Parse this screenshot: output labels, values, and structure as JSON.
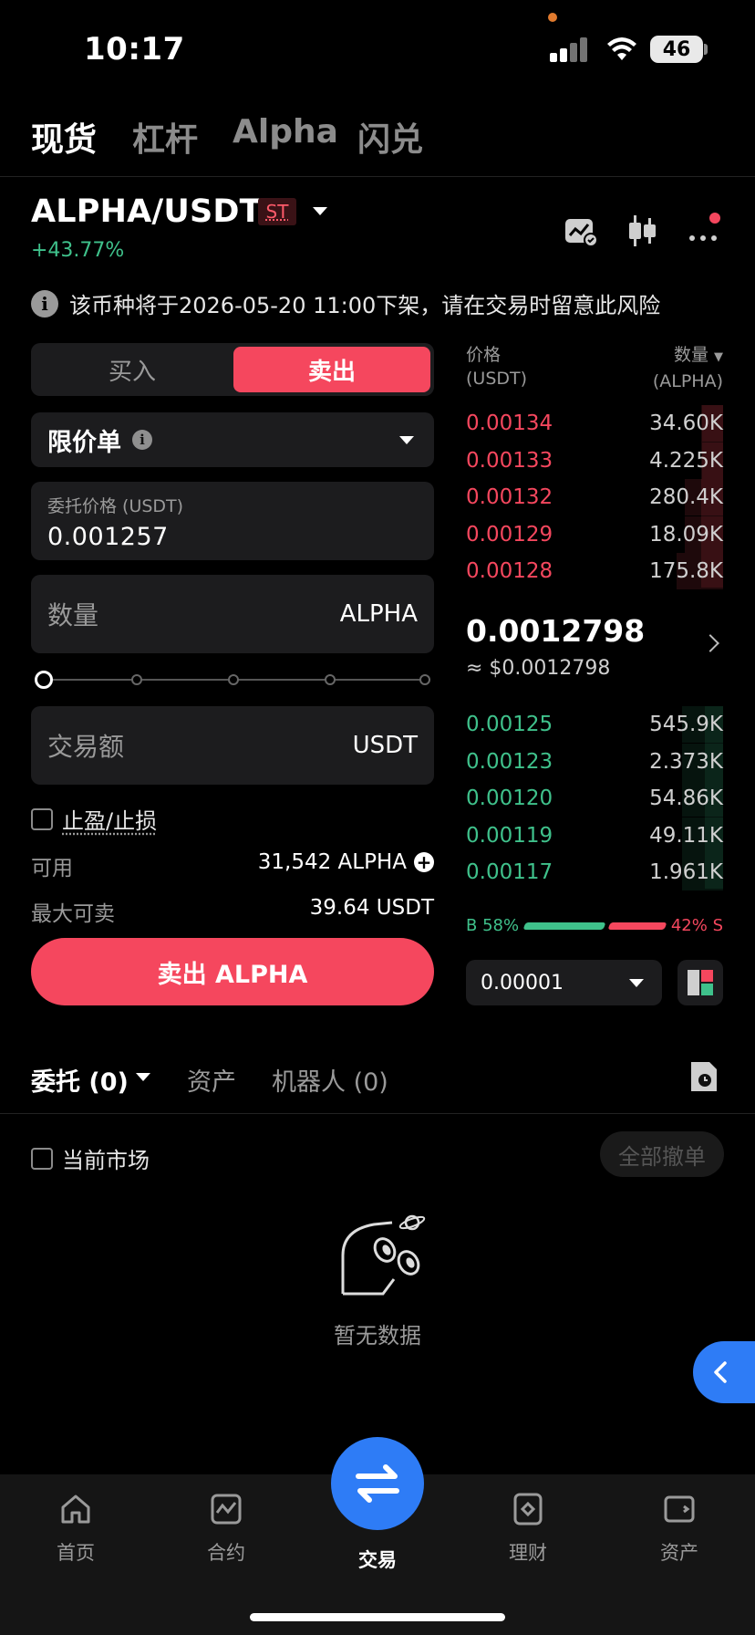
{
  "status_bar": {
    "time": "10:17",
    "battery": "46"
  },
  "top_tabs": [
    "现货",
    "杠杆",
    "Alpha",
    "闪兑"
  ],
  "pair": {
    "symbol": "ALPHA/USDT",
    "badge": "ST",
    "change": "+43.77%"
  },
  "notice": "该币种将于2026-05-20 11:00下架，请在交易时留意此风险",
  "trade_form": {
    "buy_label": "买入",
    "sell_label": "卖出",
    "order_type": "限价单",
    "price_label": "委托价格 (USDT)",
    "price_value": "0.001257",
    "amount_placeholder": "数量",
    "amount_unit": "ALPHA",
    "slider_fraction": 0,
    "total_placeholder": "交易额",
    "total_unit": "USDT",
    "tpsl_label": "止盈/止损",
    "available_label": "可用",
    "available_value": "31,542 ALPHA",
    "max_sell_label": "最大可卖",
    "max_sell_value": "39.64 USDT",
    "submit_label": "卖出 ALPHA"
  },
  "order_book": {
    "price_header": "价格",
    "price_unit": "(USDT)",
    "qty_header": "数量",
    "qty_unit": "(ALPHA)",
    "asks": [
      {
        "price": "0.00134",
        "qty": "34.60K",
        "depth": 0.08
      },
      {
        "price": "0.00133",
        "qty": "4.225K",
        "depth": 0.08
      },
      {
        "price": "0.00132",
        "qty": "280.4K",
        "depth": 0.15
      },
      {
        "price": "0.00129",
        "qty": "18.09K",
        "depth": 0.15
      },
      {
        "price": "0.00128",
        "qty": "175.8K",
        "depth": 0.18
      }
    ],
    "last_price": "0.0012798",
    "last_price_usd": "≈ $0.0012798",
    "bids": [
      {
        "price": "0.00125",
        "qty": "545.9K",
        "depth": 0.16
      },
      {
        "price": "0.00123",
        "qty": "2.373K",
        "depth": 0.16
      },
      {
        "price": "0.00120",
        "qty": "54.86K",
        "depth": 0.16
      },
      {
        "price": "0.00119",
        "qty": "49.11K",
        "depth": 0.16
      },
      {
        "price": "0.00117",
        "qty": "1.961K",
        "depth": 0.16
      }
    ],
    "buy_ratio_label": "B 58%",
    "sell_ratio_label": "42% S",
    "buy_ratio": 0.58,
    "precision": "0.00001"
  },
  "orders_section": {
    "tabs": [
      "委托 (0)",
      "资产",
      "机器人 (0)"
    ],
    "current_market_label": "当前市场",
    "cancel_all_label": "全部撤单",
    "empty_label": "暂无数据"
  },
  "bottom_nav": [
    "首页",
    "合约",
    "交易",
    "理财",
    "资产"
  ],
  "colors": {
    "sell": "#f5475e",
    "buy": "#3fc18b",
    "accent": "#2e7cf6"
  }
}
